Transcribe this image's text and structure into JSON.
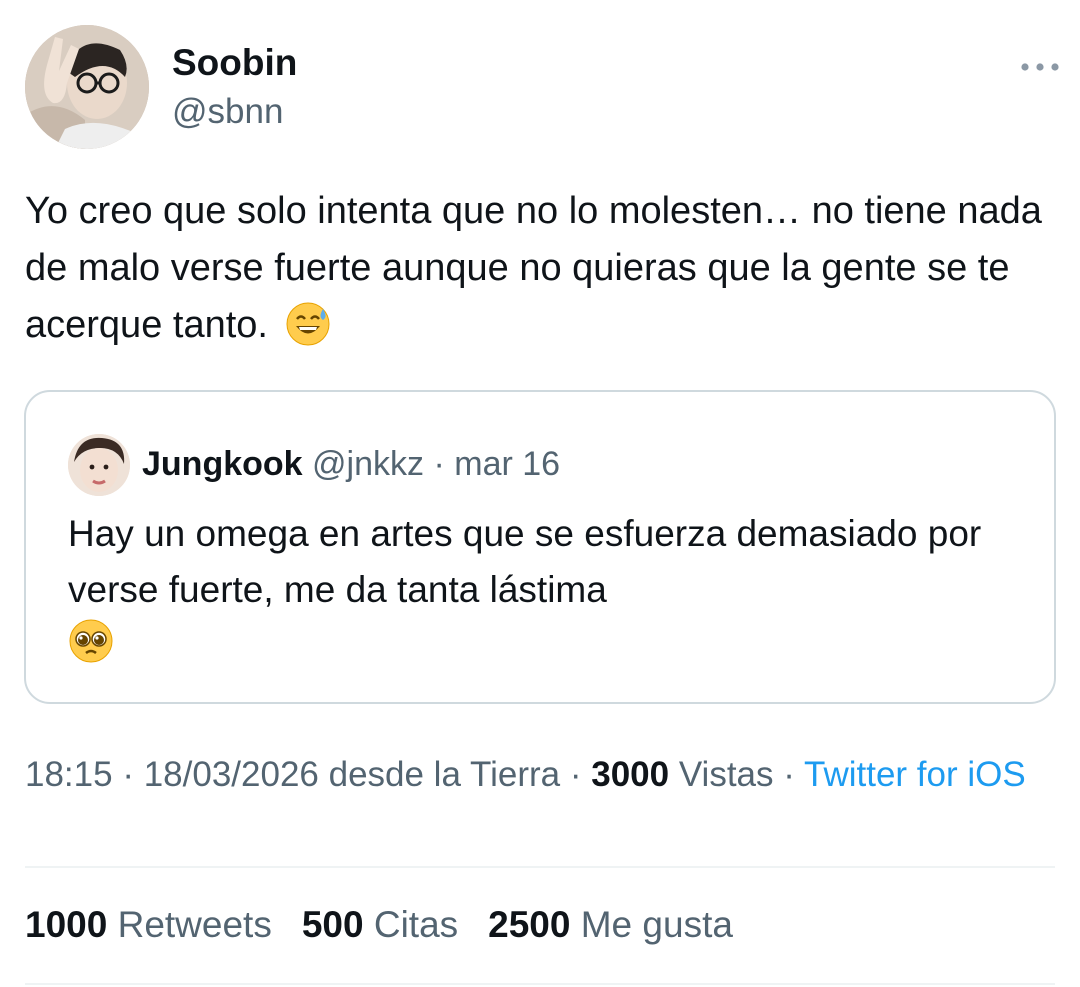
{
  "author": {
    "name": "Soobin",
    "handle": "@sbnn"
  },
  "more_icon": "more-horizontal-icon",
  "tweet": {
    "text": "Yo creo que solo intenta que no lo molesten… no tiene nada de malo verse fuerte aunque no quieras que la gente se te acerque tanto.",
    "emoji": "😅"
  },
  "quote": {
    "name": "Jungkook",
    "handle": "@jnkkz",
    "separator": "·",
    "date": "mar 16",
    "text": "Hay un omega en artes que se esfuerza demasiado por verse fuerte, me da tanta lástima",
    "emoji": "🥺"
  },
  "meta": {
    "time": "18:15",
    "sep1": " · ",
    "date": "18/03/2026 desde la Tierra",
    "sep2": " · ",
    "views_count": "3000",
    "views_label": " Vistas",
    "sep3": " · ",
    "source": "Twitter for iOS"
  },
  "stats": {
    "retweets_count": "1000",
    "retweets_label": " Retweets",
    "quotes_count": "500",
    "quotes_label": " Citas",
    "likes_count": "2500",
    "likes_label": " Me gusta"
  },
  "colors": {
    "text": "#0f1419",
    "secondary": "#536471",
    "link": "#1d9bf0",
    "border": "#cfd9de"
  }
}
